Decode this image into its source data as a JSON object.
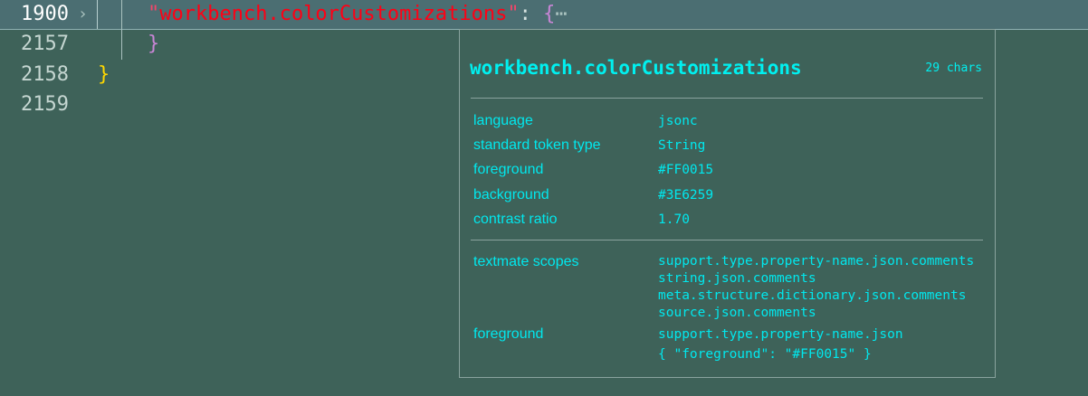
{
  "editor": {
    "lines": [
      {
        "number": "1900",
        "current": true
      },
      {
        "number": "2157",
        "current": false
      },
      {
        "number": "2158",
        "current": false
      },
      {
        "number": "2159",
        "current": false
      }
    ],
    "line1900": {
      "quote_open": "\"",
      "property": "workbench.colorCustomizations",
      "quote_close": "\"",
      "colon": ": ",
      "brace": "{",
      "ellipsis": "⋯"
    },
    "line2157": {
      "brace": "}"
    },
    "line2158": {
      "brace": "}"
    }
  },
  "hover": {
    "title": "workbench.colorCustomizations",
    "length": "29 chars",
    "rows": [
      {
        "key": "language",
        "value": "jsonc"
      },
      {
        "key": "standard token type",
        "value": "String"
      },
      {
        "key": "foreground",
        "value": "#FF0015"
      },
      {
        "key": "background",
        "value": "#3E6259"
      },
      {
        "key": "contrast ratio",
        "value": "1.70"
      }
    ],
    "scopes_label": "textmate scopes",
    "scopes": [
      "support.type.property-name.json.comments",
      "string.json.comments",
      "meta.structure.dictionary.json.comments",
      "source.json.comments"
    ],
    "foreground_label": "foreground",
    "foreground_scope": "support.type.property-name.json",
    "foreground_rule": "{ \"foreground\": \"#FF0015\" }"
  },
  "colors": {
    "background": "#3E6259",
    "token_foreground": "#FF0015",
    "hover_text": "#00E8EE"
  }
}
